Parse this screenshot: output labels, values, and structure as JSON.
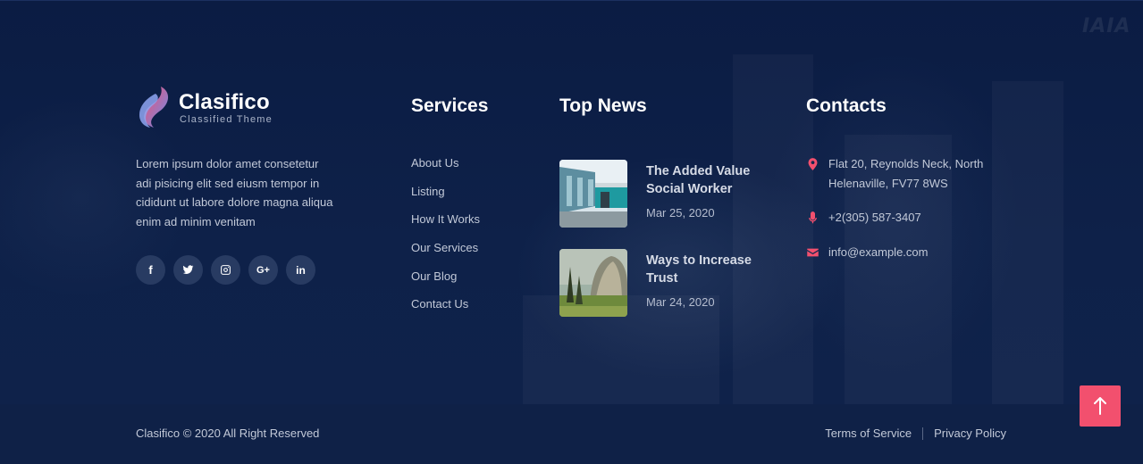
{
  "brand": {
    "name": "Clasifico",
    "tagline": "Classified Theme",
    "about": "Lorem ipsum dolor amet consetetur adi pisicing elit sed eiusm tempor in cididunt ut labore dolore magna aliqua enim ad minim venitam"
  },
  "social": [
    {
      "icon": "facebook-icon",
      "glyph": "f"
    },
    {
      "icon": "twitter-icon"
    },
    {
      "icon": "instagram-icon"
    },
    {
      "icon": "google-plus-icon",
      "glyph": "G+"
    },
    {
      "icon": "linkedin-icon",
      "glyph": "in"
    }
  ],
  "services": {
    "title": "Services",
    "links": [
      "About Us",
      "Listing",
      "How It Works",
      "Our Services",
      "Our Blog",
      "Contact Us"
    ]
  },
  "news": {
    "title": "Top News",
    "items": [
      {
        "title": "The Added Value Social Worker",
        "date": "Mar 25, 2020"
      },
      {
        "title": "Ways to Increase Trust",
        "date": "Mar 24, 2020"
      }
    ]
  },
  "contacts": {
    "title": "Contacts",
    "address": "Flat 20, Reynolds Neck, North Helenaville, FV77 8WS",
    "phone": "+2(305) 587-3407",
    "email": "info@example.com"
  },
  "bottom": {
    "copyright": "Clasifico © 2020 All Right Reserved",
    "terms": "Terms of Service",
    "privacy": "Privacy Policy"
  },
  "colors": {
    "accent": "#f2506e",
    "background": "#0c1e45"
  }
}
